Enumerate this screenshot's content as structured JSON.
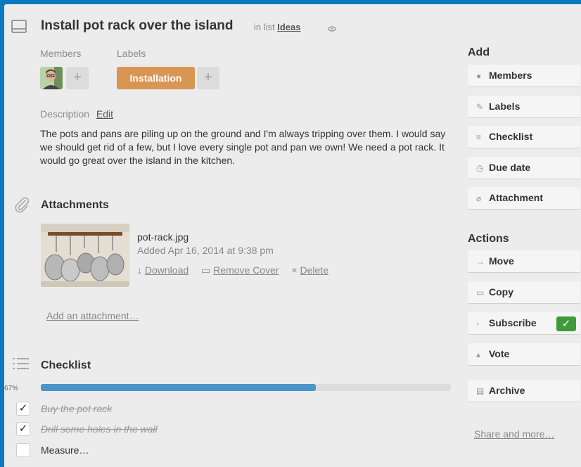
{
  "card": {
    "title": "Install pot rack over the island",
    "in_list_prefix": "in list",
    "list_name": "Ideas"
  },
  "members": {
    "heading": "Members"
  },
  "labels": {
    "heading": "Labels",
    "items": [
      {
        "text": "Installation",
        "color": "#d99552"
      }
    ]
  },
  "description": {
    "heading": "Description",
    "edit_label": "Edit",
    "text": "The pots and pans are piling up on the ground and I'm always tripping over them. I would say we should get rid of a few, but I love every single pot and pan we own! We need a pot rack. It would go great over the island in the kitchen."
  },
  "attachments": {
    "heading": "Attachments",
    "file": {
      "name": "pot-rack.jpg",
      "added": "Added Apr 16, 2014 at 9:38 pm",
      "download_label": "Download",
      "remove_cover_label": "Remove Cover",
      "delete_label": "Delete"
    },
    "add_label": "Add an attachment…"
  },
  "checklist": {
    "heading": "Checklist",
    "percent_text": "67%",
    "progress": 0.67,
    "progress_color": "#4a94c8",
    "items": [
      {
        "text": "Buy the pot rack",
        "done": true
      },
      {
        "text": "Drill some holes in the wall",
        "done": true
      },
      {
        "text": "Measure…",
        "done": false
      }
    ]
  },
  "sidebar": {
    "add_heading": "Add",
    "add_buttons": [
      {
        "label": "Members",
        "icon": "person-icon"
      },
      {
        "label": "Labels",
        "icon": "tag-icon"
      },
      {
        "label": "Checklist",
        "icon": "list-icon"
      },
      {
        "label": "Due date",
        "icon": "clock-icon"
      },
      {
        "label": "Attachment",
        "icon": "paperclip-icon"
      }
    ],
    "actions_heading": "Actions",
    "action_buttons": [
      {
        "label": "Move",
        "icon": "arrow-right-icon"
      },
      {
        "label": "Copy",
        "icon": "card-icon"
      },
      {
        "label": "Subscribe",
        "icon": "eye-icon"
      },
      {
        "label": "Vote",
        "icon": "thumbs-up-icon"
      },
      {
        "label": "Archive",
        "icon": "archive-icon"
      }
    ],
    "share_label": "Share and more…"
  }
}
